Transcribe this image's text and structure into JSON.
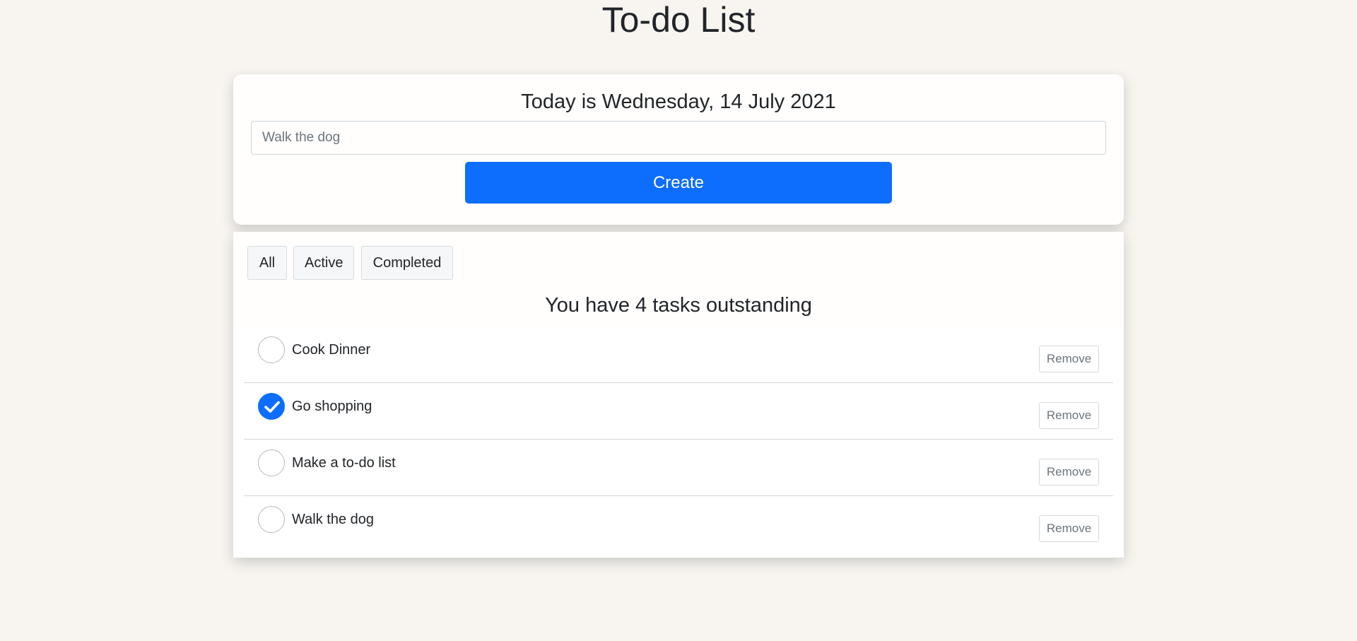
{
  "app": {
    "title": "To-do List"
  },
  "create_form": {
    "date_heading": "Today is Wednesday, 14 July 2021",
    "input_value": "",
    "input_placeholder": "Walk the dog",
    "create_label": "Create"
  },
  "filters": [
    {
      "label": "All"
    },
    {
      "label": "Active"
    },
    {
      "label": "Completed"
    }
  ],
  "summary": "You have 4 tasks outstanding",
  "tasks": [
    {
      "label": "Cook Dinner",
      "completed": false,
      "remove_label": "Remove"
    },
    {
      "label": "Go shopping",
      "completed": true,
      "remove_label": "Remove"
    },
    {
      "label": "Make a to-do list",
      "completed": false,
      "remove_label": "Remove"
    },
    {
      "label": "Walk the dog",
      "completed": false,
      "remove_label": "Remove"
    }
  ],
  "colors": {
    "background": "#f8f5f1",
    "accent": "#0d6efd",
    "text": "#212529",
    "muted": "#6c757d"
  },
  "icons": {
    "checked": "checkmark-icon",
    "unchecked": "empty-circle-icon"
  }
}
